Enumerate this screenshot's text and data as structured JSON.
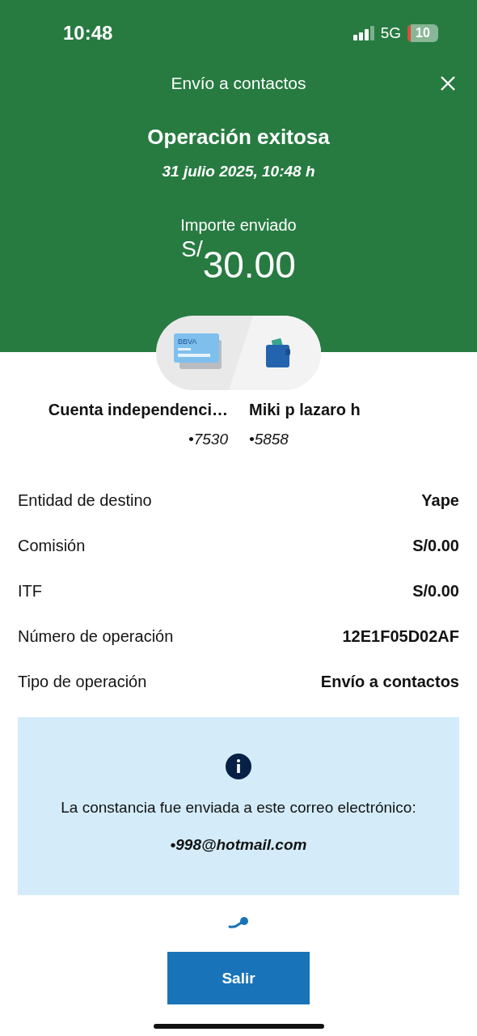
{
  "status_bar": {
    "time": "10:48",
    "network": "5G",
    "battery": "10"
  },
  "header": {
    "title": "Envío a contactos",
    "heading": "Operación exitosa",
    "date": "31 julio 2025, 10:48 h",
    "amount_label": "Importe enviado",
    "currency": "S/",
    "amount": "30.00"
  },
  "transfer": {
    "card_label": "BBVA",
    "from": {
      "name": "Cuenta independenci…",
      "number": "•7530"
    },
    "to": {
      "name": "Miki p lazaro h",
      "number": "•5858"
    }
  },
  "details": [
    {
      "label": "Entidad de destino",
      "value": "Yape"
    },
    {
      "label": "Comisión",
      "value": "S/0.00"
    },
    {
      "label": "ITF",
      "value": "S/0.00"
    },
    {
      "label": "Número de operación",
      "value": "12E1F05D02AF"
    },
    {
      "label": "Tipo de operación",
      "value": "Envío a contactos"
    }
  ],
  "notice": {
    "text": "La constancia fue enviada a este correo electrónico:",
    "email": "•998@hotmail.com"
  },
  "buttons": [
    {
      "label": "Salir"
    }
  ]
}
